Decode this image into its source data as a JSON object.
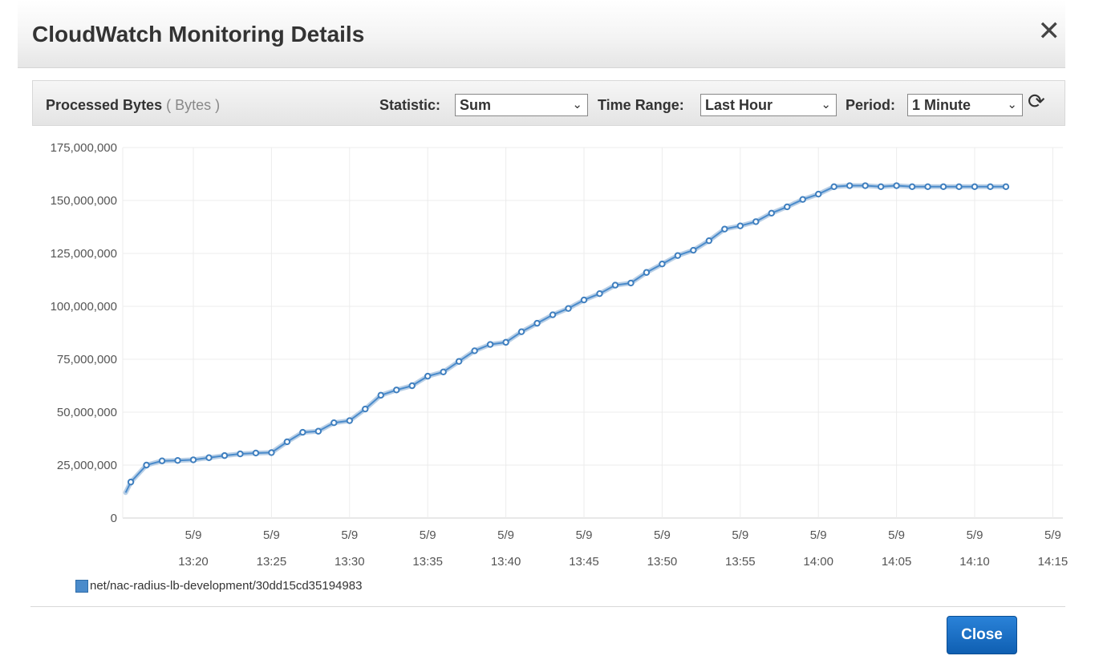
{
  "modal": {
    "title": "CloudWatch Monitoring Details",
    "close_glyph": "✕",
    "close_button_label": "Close"
  },
  "toolbar": {
    "metric_name": "Processed Bytes",
    "metric_unit": "( Bytes )",
    "statistic_label": "Statistic:",
    "statistic_value": "Sum",
    "time_range_label": "Time Range:",
    "time_range_value": "Last Hour",
    "period_label": "Period:",
    "period_value": "1 Minute",
    "refresh_icon": "refresh-icon"
  },
  "legend": {
    "series_label": "net/nac-radius-lb-development/30dd15cd35194983",
    "color": "#4a8bcb"
  },
  "chart_data": {
    "type": "line",
    "title": "",
    "xlabel": "",
    "ylabel": "",
    "ylim": [
      0,
      175000000
    ],
    "y_ticks": [
      "0",
      "25,000,000",
      "50,000,000",
      "75,000,000",
      "100,000,000",
      "125,000,000",
      "150,000,000",
      "175,000,000"
    ],
    "x_ticks": [
      {
        "date": "5/9",
        "time": "13:20"
      },
      {
        "date": "5/9",
        "time": "13:25"
      },
      {
        "date": "5/9",
        "time": "13:30"
      },
      {
        "date": "5/9",
        "time": "13:35"
      },
      {
        "date": "5/9",
        "time": "13:40"
      },
      {
        "date": "5/9",
        "time": "13:45"
      },
      {
        "date": "5/9",
        "time": "13:50"
      },
      {
        "date": "5/9",
        "time": "13:55"
      },
      {
        "date": "5/9",
        "time": "14:00"
      },
      {
        "date": "5/9",
        "time": "14:05"
      },
      {
        "date": "5/9",
        "time": "14:10"
      },
      {
        "date": "5/9",
        "time": "14:15"
      }
    ],
    "x": [
      "13:15:40",
      "13:16",
      "13:17",
      "13:18",
      "13:19",
      "13:20",
      "13:21",
      "13:22",
      "13:23",
      "13:24",
      "13:25",
      "13:26",
      "13:27",
      "13:28",
      "13:29",
      "13:30",
      "13:31",
      "13:32",
      "13:33",
      "13:34",
      "13:35",
      "13:36",
      "13:37",
      "13:38",
      "13:39",
      "13:40",
      "13:41",
      "13:42",
      "13:43",
      "13:44",
      "13:45",
      "13:46",
      "13:47",
      "13:48",
      "13:49",
      "13:50",
      "13:51",
      "13:52",
      "13:53",
      "13:54",
      "13:55",
      "13:56",
      "13:57",
      "13:58",
      "13:59",
      "14:00",
      "14:01",
      "14:02",
      "14:03",
      "14:04",
      "14:05",
      "14:06",
      "14:07",
      "14:08",
      "14:09",
      "14:10",
      "14:11",
      "14:12"
    ],
    "series": [
      {
        "color": "#4a8bcb",
        "values": [
          12000000,
          17000000,
          25000000,
          27000000,
          27200000,
          27500000,
          28500000,
          29500000,
          30300000,
          30700000,
          30900000,
          36000000,
          40500000,
          41000000,
          45000000,
          46000000,
          51500000,
          58000000,
          60500000,
          62500000,
          67000000,
          69000000,
          74000000,
          79000000,
          82000000,
          83000000,
          88000000,
          92000000,
          96000000,
          99000000,
          103000000,
          106000000,
          110000000,
          111000000,
          116000000,
          120000000,
          124000000,
          126500000,
          131000000,
          136500000,
          138000000,
          140000000,
          144000000,
          147000000,
          150500000,
          153000000,
          156500000,
          157000000,
          157000000,
          156500000,
          157000000,
          156500000,
          156500000,
          156500000,
          156500000,
          156500000,
          156500000,
          156500000
        ]
      }
    ],
    "grid": true,
    "legend_position": "bottom-left"
  }
}
